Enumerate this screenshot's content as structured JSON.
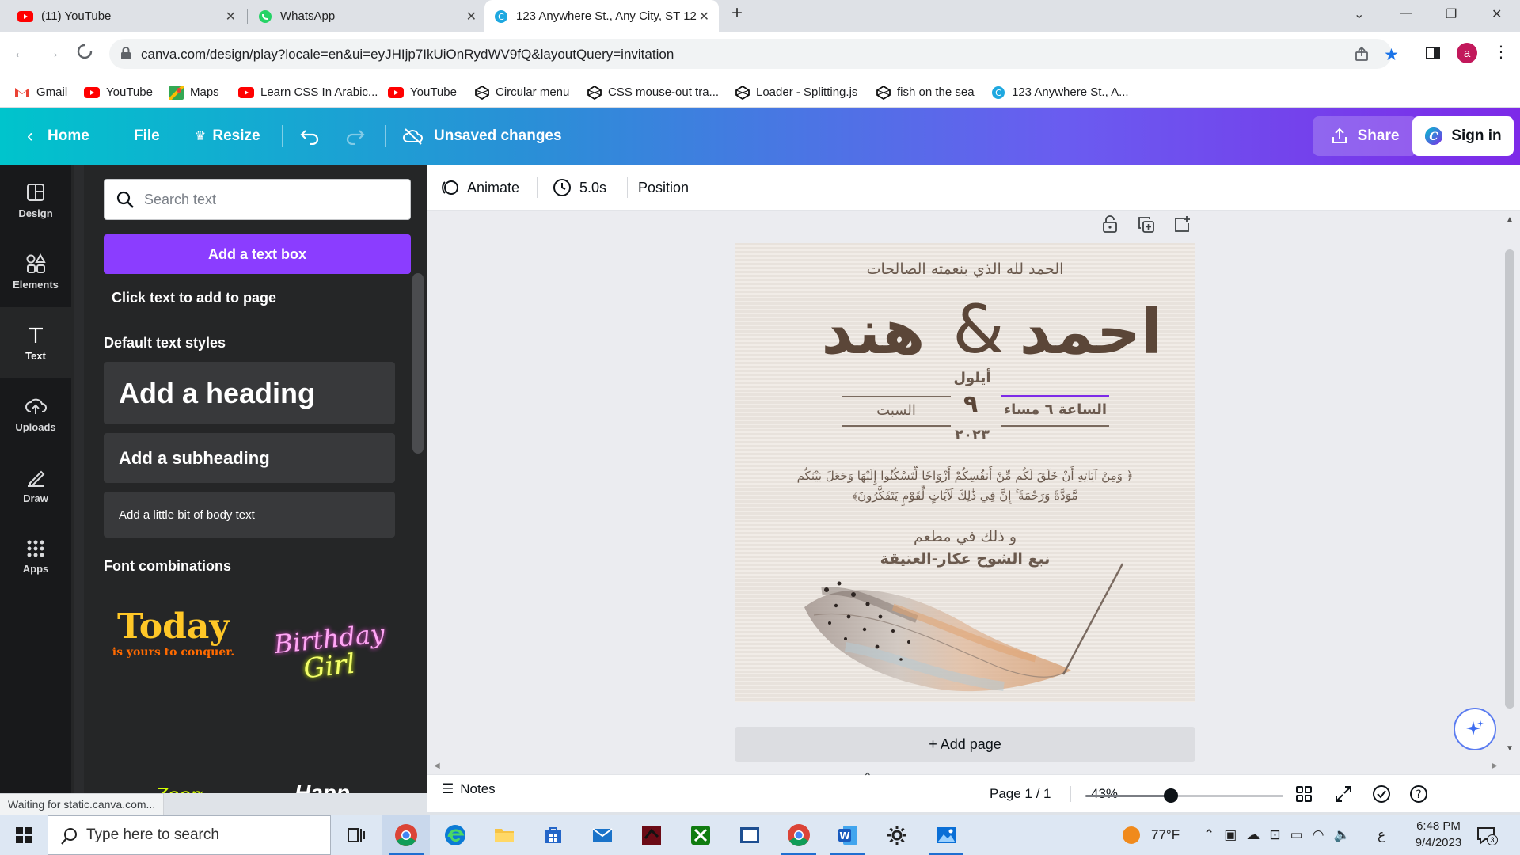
{
  "browser": {
    "tabs": [
      {
        "title": "(11) YouTube",
        "icon": "youtube-icon"
      },
      {
        "title": "WhatsApp",
        "icon": "whatsapp-icon"
      },
      {
        "title": "123 Anywhere St., Any City, ST 12",
        "icon": "canva-icon"
      }
    ],
    "url": "canva.com/design/play?locale=en&ui=eyJHIjp7IkUiOnRydWV9fQ&layoutQuery=invitation",
    "profile_initial": "a",
    "bookmarks": [
      "Gmail",
      "YouTube",
      "Maps",
      "Learn CSS In Arabic...",
      "YouTube",
      "Circular menu",
      "CSS mouse-out tra...",
      "Loader - Splitting.js",
      "fish on the sea",
      "123 Anywhere St., A..."
    ]
  },
  "header": {
    "home": "Home",
    "file": "File",
    "resize": "Resize",
    "status": "Unsaved changes",
    "share": "Share",
    "signin": "Sign in"
  },
  "rail": [
    {
      "label": "Design",
      "icon": "design-icon"
    },
    {
      "label": "Elements",
      "icon": "elements-icon"
    },
    {
      "label": "Text",
      "icon": "text-icon"
    },
    {
      "label": "Uploads",
      "icon": "upload-icon"
    },
    {
      "label": "Draw",
      "icon": "draw-icon"
    },
    {
      "label": "Apps",
      "icon": "apps-icon"
    }
  ],
  "panel": {
    "search_placeholder": "Search text",
    "add_textbox": "Add a text box",
    "hint": "Click text to add to page",
    "default_styles_heading": "Default text styles",
    "heading": "Add a heading",
    "subheading": "Add a subheading",
    "body": "Add a little bit of body text",
    "font_combinations_heading": "Font combinations",
    "combo1_main": "Today",
    "combo1_sub": "is yours to conquer.",
    "combo2_line1": "Birthday",
    "combo2_line2": "Girl"
  },
  "toolbar": {
    "animate": "Animate",
    "duration": "5.0s",
    "position": "Position"
  },
  "card": {
    "top_line": "الحمد لله الذي بنعمته الصالحات",
    "name_right": "احمد",
    "ampersand": "&",
    "name_left": "هند",
    "month": "أيلول",
    "day": "٩",
    "year": "٢٠٢٣",
    "weekday": "السبت",
    "time": "الساعة ٦ مساء",
    "verse_line1": "﴿ وَمِنْ آيَاتِهِ أَنْ خَلَقَ لَكُم مِّنْ أَنفُسِكُمْ أَزْوَاجًا لِّتَسْكُنُوا إِلَيْهَا وَجَعَلَ بَيْنَكُم",
    "verse_line2": "مَّوَدَّةً وَرَحْمَةً ۚ إِنَّ فِي ذَٰلِكَ لَآيَاتٍ لِّقَوْمٍ يَتَفَكَّرُونَ﴾",
    "venue_line1": "و ذلك في مطعم",
    "venue_line2": "نبع الشوح عكار-العتيقة"
  },
  "add_page": "+ Add page",
  "footer": {
    "notes": "Notes",
    "page": "Page 1 / 1",
    "zoom": "43%",
    "zoom_value": 0.43
  },
  "status_bar": "Waiting for static.canva.com...",
  "taskbar": {
    "search_placeholder": "Type here to search",
    "weather": "77°F",
    "lang": "ع",
    "time": "6:48 PM",
    "date": "9/4/2023",
    "notif_count": "3"
  },
  "colors": {
    "canva_purple": "#8b3dff",
    "header_start": "#00c4cc",
    "header_end": "#7d2ae8",
    "card_text": "#6b5a4e",
    "card_underline_accent": "#7d2ae8"
  }
}
